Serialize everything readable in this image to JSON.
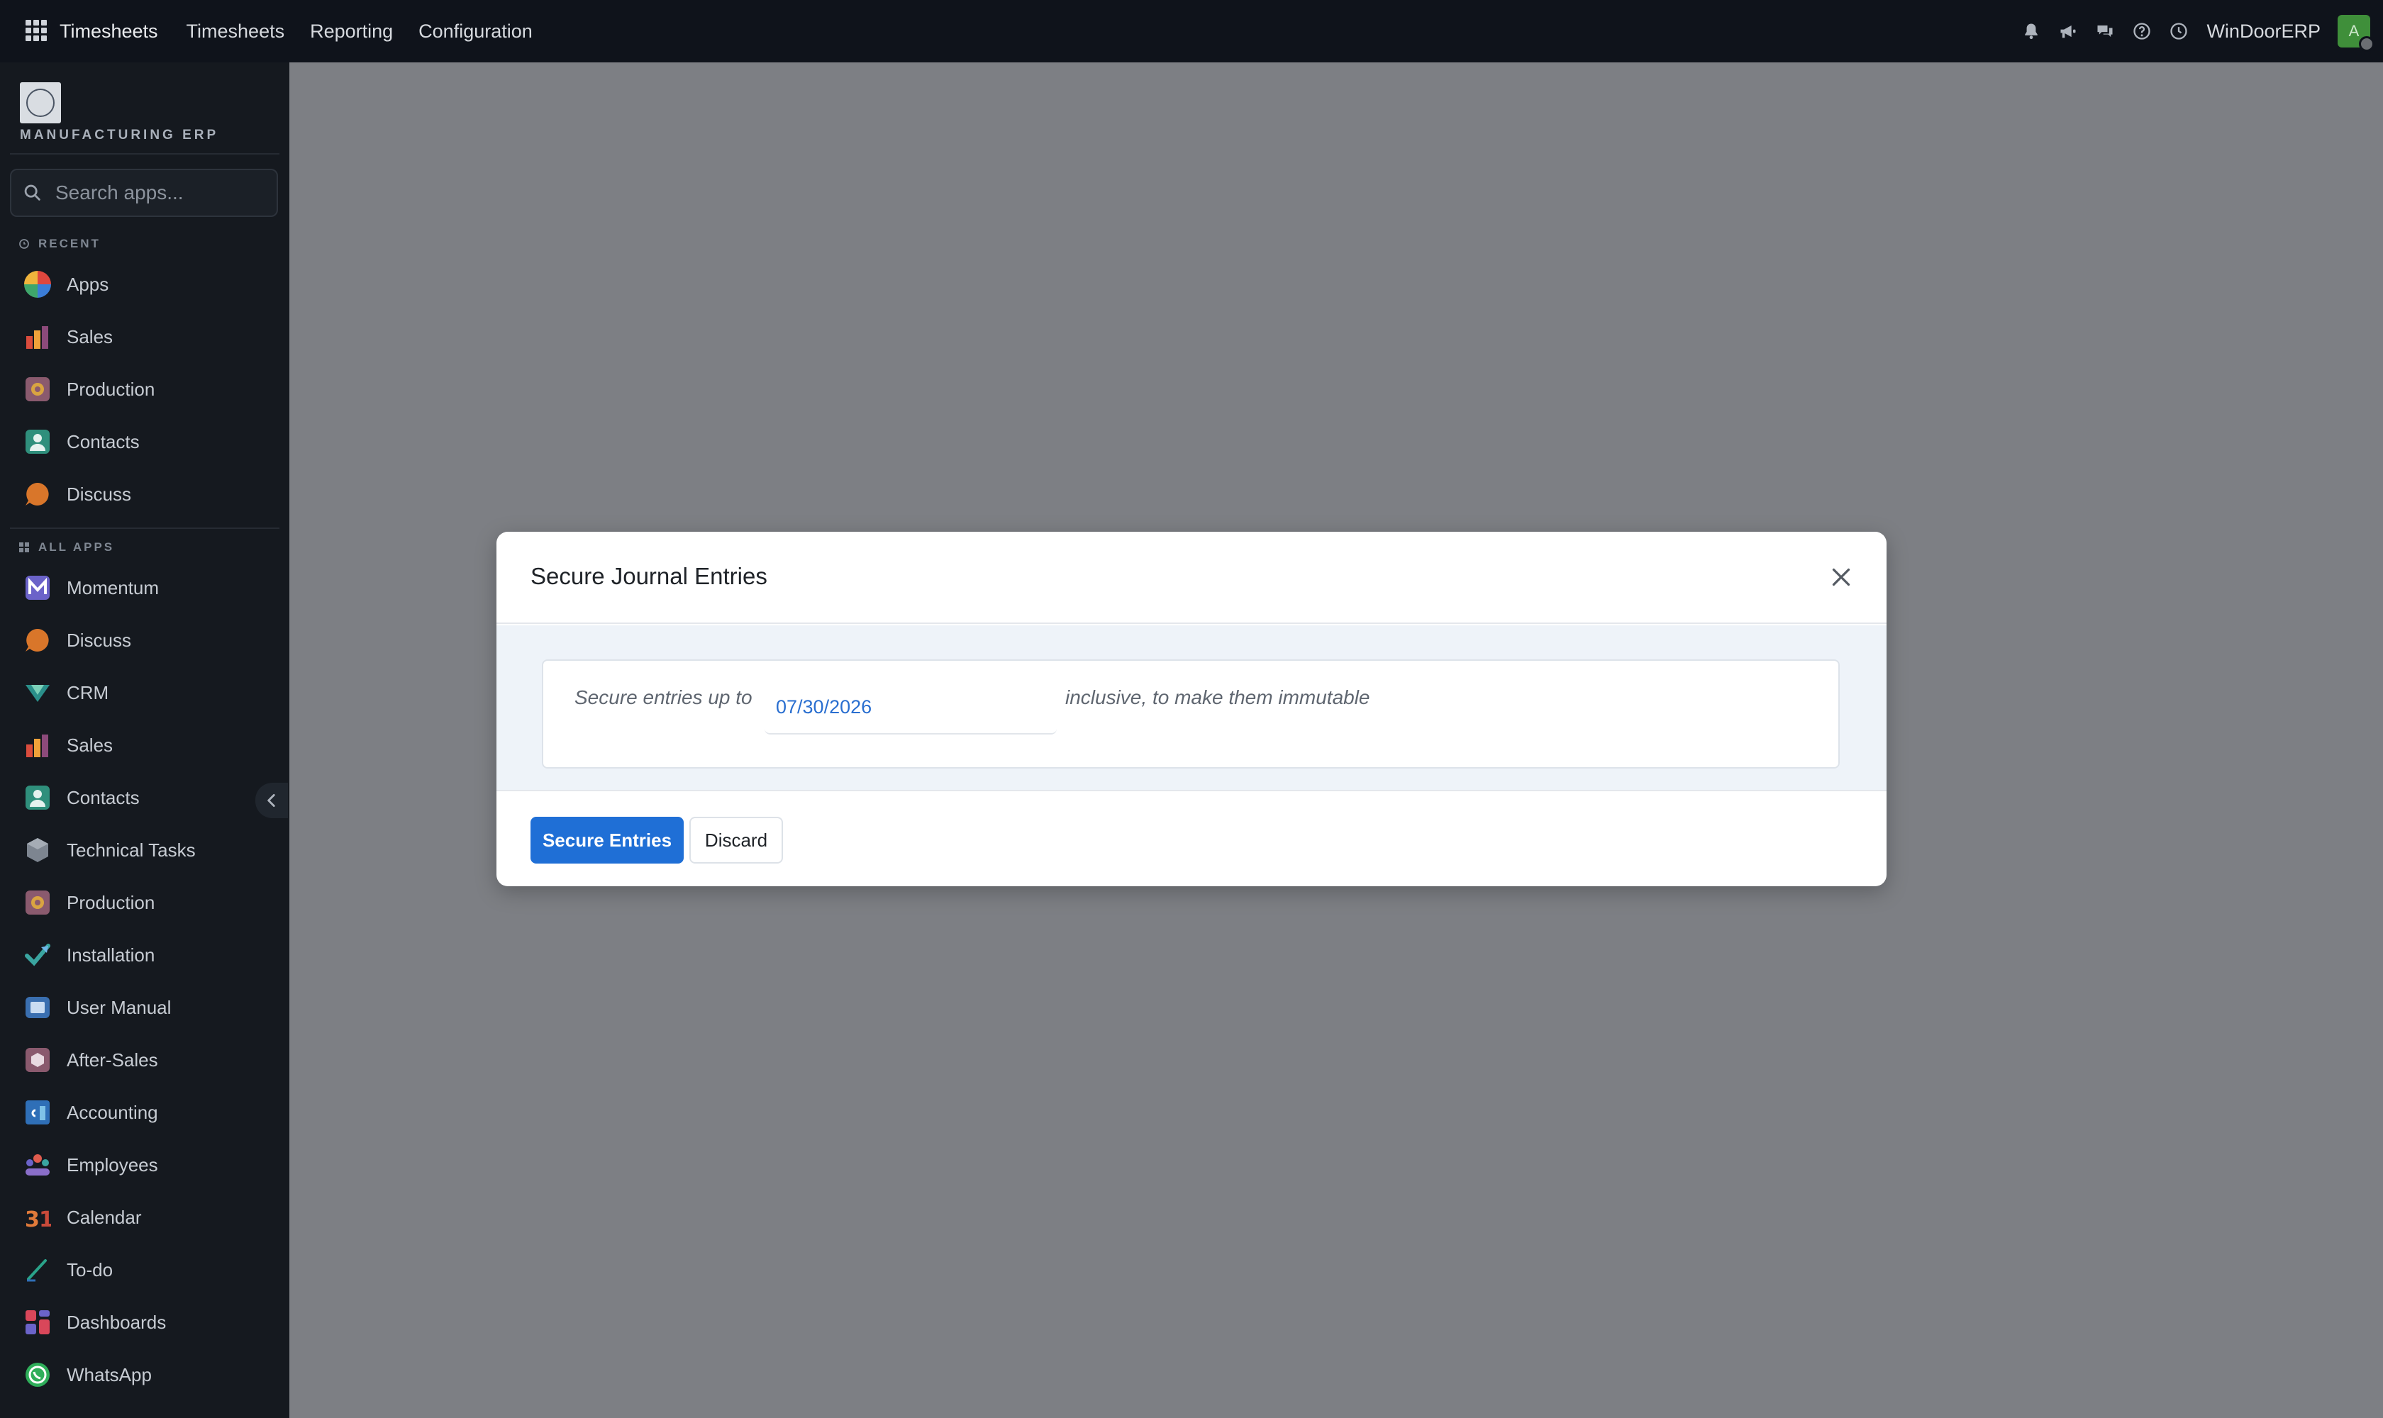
{
  "topbar": {
    "menu": [
      "Timesheets",
      "Timesheets",
      "Reporting",
      "Configuration"
    ],
    "company": "WinDoorERP",
    "avatar_letter": "A"
  },
  "sidebar": {
    "logo_text": "MANUFACTURING ERP",
    "search_placeholder": "Search apps...",
    "recent_label": "RECENT",
    "all_apps_label": "ALL APPS",
    "recent": [
      {
        "label": "Apps",
        "icon": "apps-icon"
      },
      {
        "label": "Sales",
        "icon": "sales-icon"
      },
      {
        "label": "Production",
        "icon": "production-icon"
      },
      {
        "label": "Contacts",
        "icon": "contacts-icon"
      },
      {
        "label": "Discuss",
        "icon": "discuss-icon"
      }
    ],
    "all_apps": [
      {
        "label": "Momentum",
        "icon": "momentum-icon"
      },
      {
        "label": "Discuss",
        "icon": "discuss-icon"
      },
      {
        "label": "CRM",
        "icon": "crm-icon"
      },
      {
        "label": "Sales",
        "icon": "sales-icon"
      },
      {
        "label": "Contacts",
        "icon": "contacts-icon"
      },
      {
        "label": "Technical Tasks",
        "icon": "technical-tasks-icon"
      },
      {
        "label": "Production",
        "icon": "production-icon"
      },
      {
        "label": "Installation",
        "icon": "installation-icon"
      },
      {
        "label": "User Manual",
        "icon": "user-manual-icon"
      },
      {
        "label": "After-Sales",
        "icon": "after-sales-icon"
      },
      {
        "label": "Accounting",
        "icon": "accounting-icon"
      },
      {
        "label": "Employees",
        "icon": "employees-icon"
      },
      {
        "label": "Calendar",
        "icon": "calendar-icon"
      },
      {
        "label": "To-do",
        "icon": "todo-icon"
      },
      {
        "label": "Dashboards",
        "icon": "dashboards-icon"
      },
      {
        "label": "WhatsApp",
        "icon": "whatsapp-icon"
      }
    ]
  },
  "modal": {
    "title": "Secure Journal Entries",
    "prefix_text": "Secure entries up to",
    "date_value": "07/30/2026",
    "suffix_text": "inclusive, to make them immutable",
    "primary_button": "Secure Entries",
    "secondary_button": "Discard"
  },
  "colors": {
    "primary": "#1f6fd6",
    "topbar_bg": "#0f131b",
    "sidebar_bg": "#15191f",
    "backdrop": "#7d7f84",
    "date_text": "#2a6fd0"
  }
}
